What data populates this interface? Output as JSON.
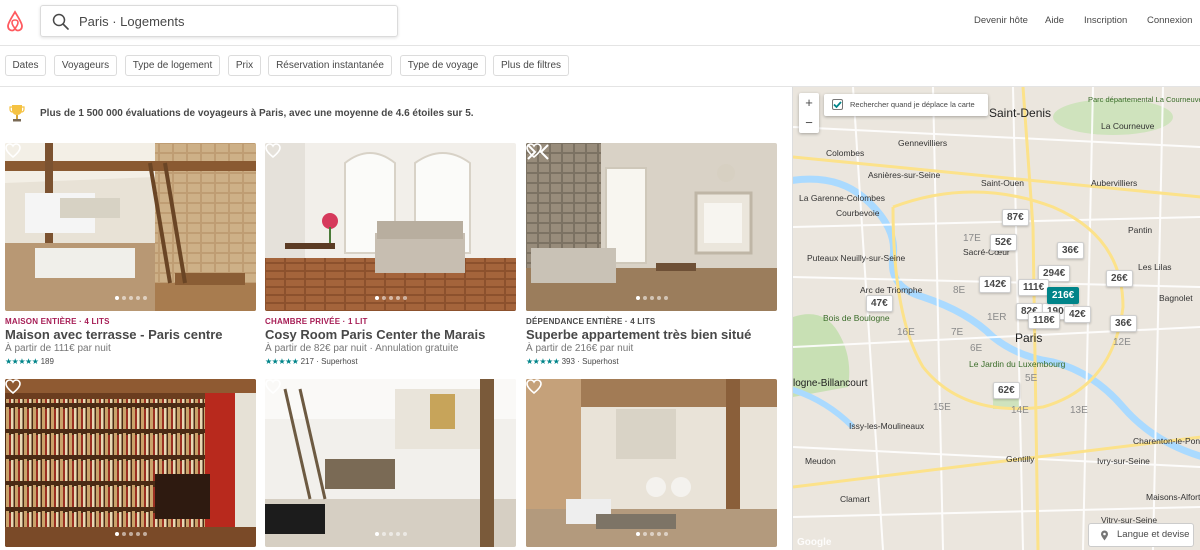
{
  "search": {
    "value": "Paris · Logements"
  },
  "nav": {
    "host": "Devenir hôte",
    "help": "Aide",
    "signup": "Inscription",
    "login": "Connexion"
  },
  "filters": [
    "Dates",
    "Voyageurs",
    "Type de logement",
    "Prix",
    "Réservation instantanée",
    "Type de voyage",
    "Plus de filtres"
  ],
  "banner": "Plus de 1 500 000 évaluations de voyageurs à Paris, avec une moyenne de 4.6 étoiles sur 5.",
  "accent": "#008489",
  "listings": [
    {
      "kicker": "MAISON ENTIÈRE · 4 LITS",
      "kicker_color": "#a61d55",
      "title": "Maison avec terrasse - Paris centre",
      "price": "À partir de 111€ par nuit",
      "stars": "★★★★★",
      "reviews": "189",
      "superhost": ""
    },
    {
      "kicker": "CHAMBRE PRIVÉE · 1 LIT",
      "kicker_color": "#a61d55",
      "title": "Cosy Room Paris Center the Marais",
      "price": "À partir de 82€ par nuit · Annulation gratuite",
      "stars": "★★★★★",
      "reviews": "217",
      "superhost": "· Superhost"
    },
    {
      "kicker": "DÉPENDANCE ENTIÈRE · 4 LITS",
      "kicker_color": "#484848",
      "title": "Superbe appartement très bien situé",
      "price": "À partir de 216€ par nuit",
      "stars": "★★★★★",
      "reviews": "393",
      "superhost": "· Superhost"
    }
  ],
  "map": {
    "zoom_in": "+",
    "zoom_out": "−",
    "check_label": "Rechercher quand je déplace la carte",
    "lang_label": "Langue et devise",
    "google": "Google",
    "prices": [
      "87€",
      "52€",
      "36€",
      "294€",
      "26€",
      "142€",
      "111€",
      "216€",
      "47€",
      "82€",
      "190€",
      "42€",
      "118€",
      "36€",
      "62€"
    ],
    "places": {
      "saint_denis": "Saint-Denis",
      "paris": "Paris",
      "colombes": "Colombes",
      "gennevilliers": "Gennevilliers",
      "asnieres": "Asnières-sur-Seine",
      "la_garenne": "La Garenne-Colombes",
      "courbevoie": "Courbevoie",
      "saint_ouen": "Saint-Ouen",
      "aubervilliers": "Aubervilliers",
      "la_courneuve": "La Courneuve",
      "pantin": "Pantin",
      "les_lilas": "Les Lilas",
      "bagnolet": "Bagnolet",
      "puteaux": "Puteaux Neuilly-sur-Seine",
      "arc": "Arc de Triomphe",
      "bois_boulogne": "Bois de Boulogne",
      "boulogne": "logne-Billancourt",
      "luxembourg": "Le Jardin du Luxembourg",
      "issy": "Issy-les-Moulineaux",
      "meudon": "Meudon",
      "clamart": "Clamart",
      "ivry": "Ivry-sur-Seine",
      "charenton": "Charenton-le-Pont",
      "maisons": "Maisons-Alfort",
      "vitry": "Vitry-sur-Seine",
      "gentilly": "Gentilly",
      "sacre": "Sacré-Cœur",
      "parc": "Parc départemental La Courneuve Valbon",
      "arr_17": "17E",
      "arr_8": "8E",
      "arr_16": "16E",
      "arr_7": "7E",
      "arr_15": "15E",
      "arr_14": "14E",
      "arr_13": "13E",
      "arr_1": "1ER",
      "arr_6": "6E",
      "arr_12": "12E",
      "arr_5": "5E"
    }
  }
}
